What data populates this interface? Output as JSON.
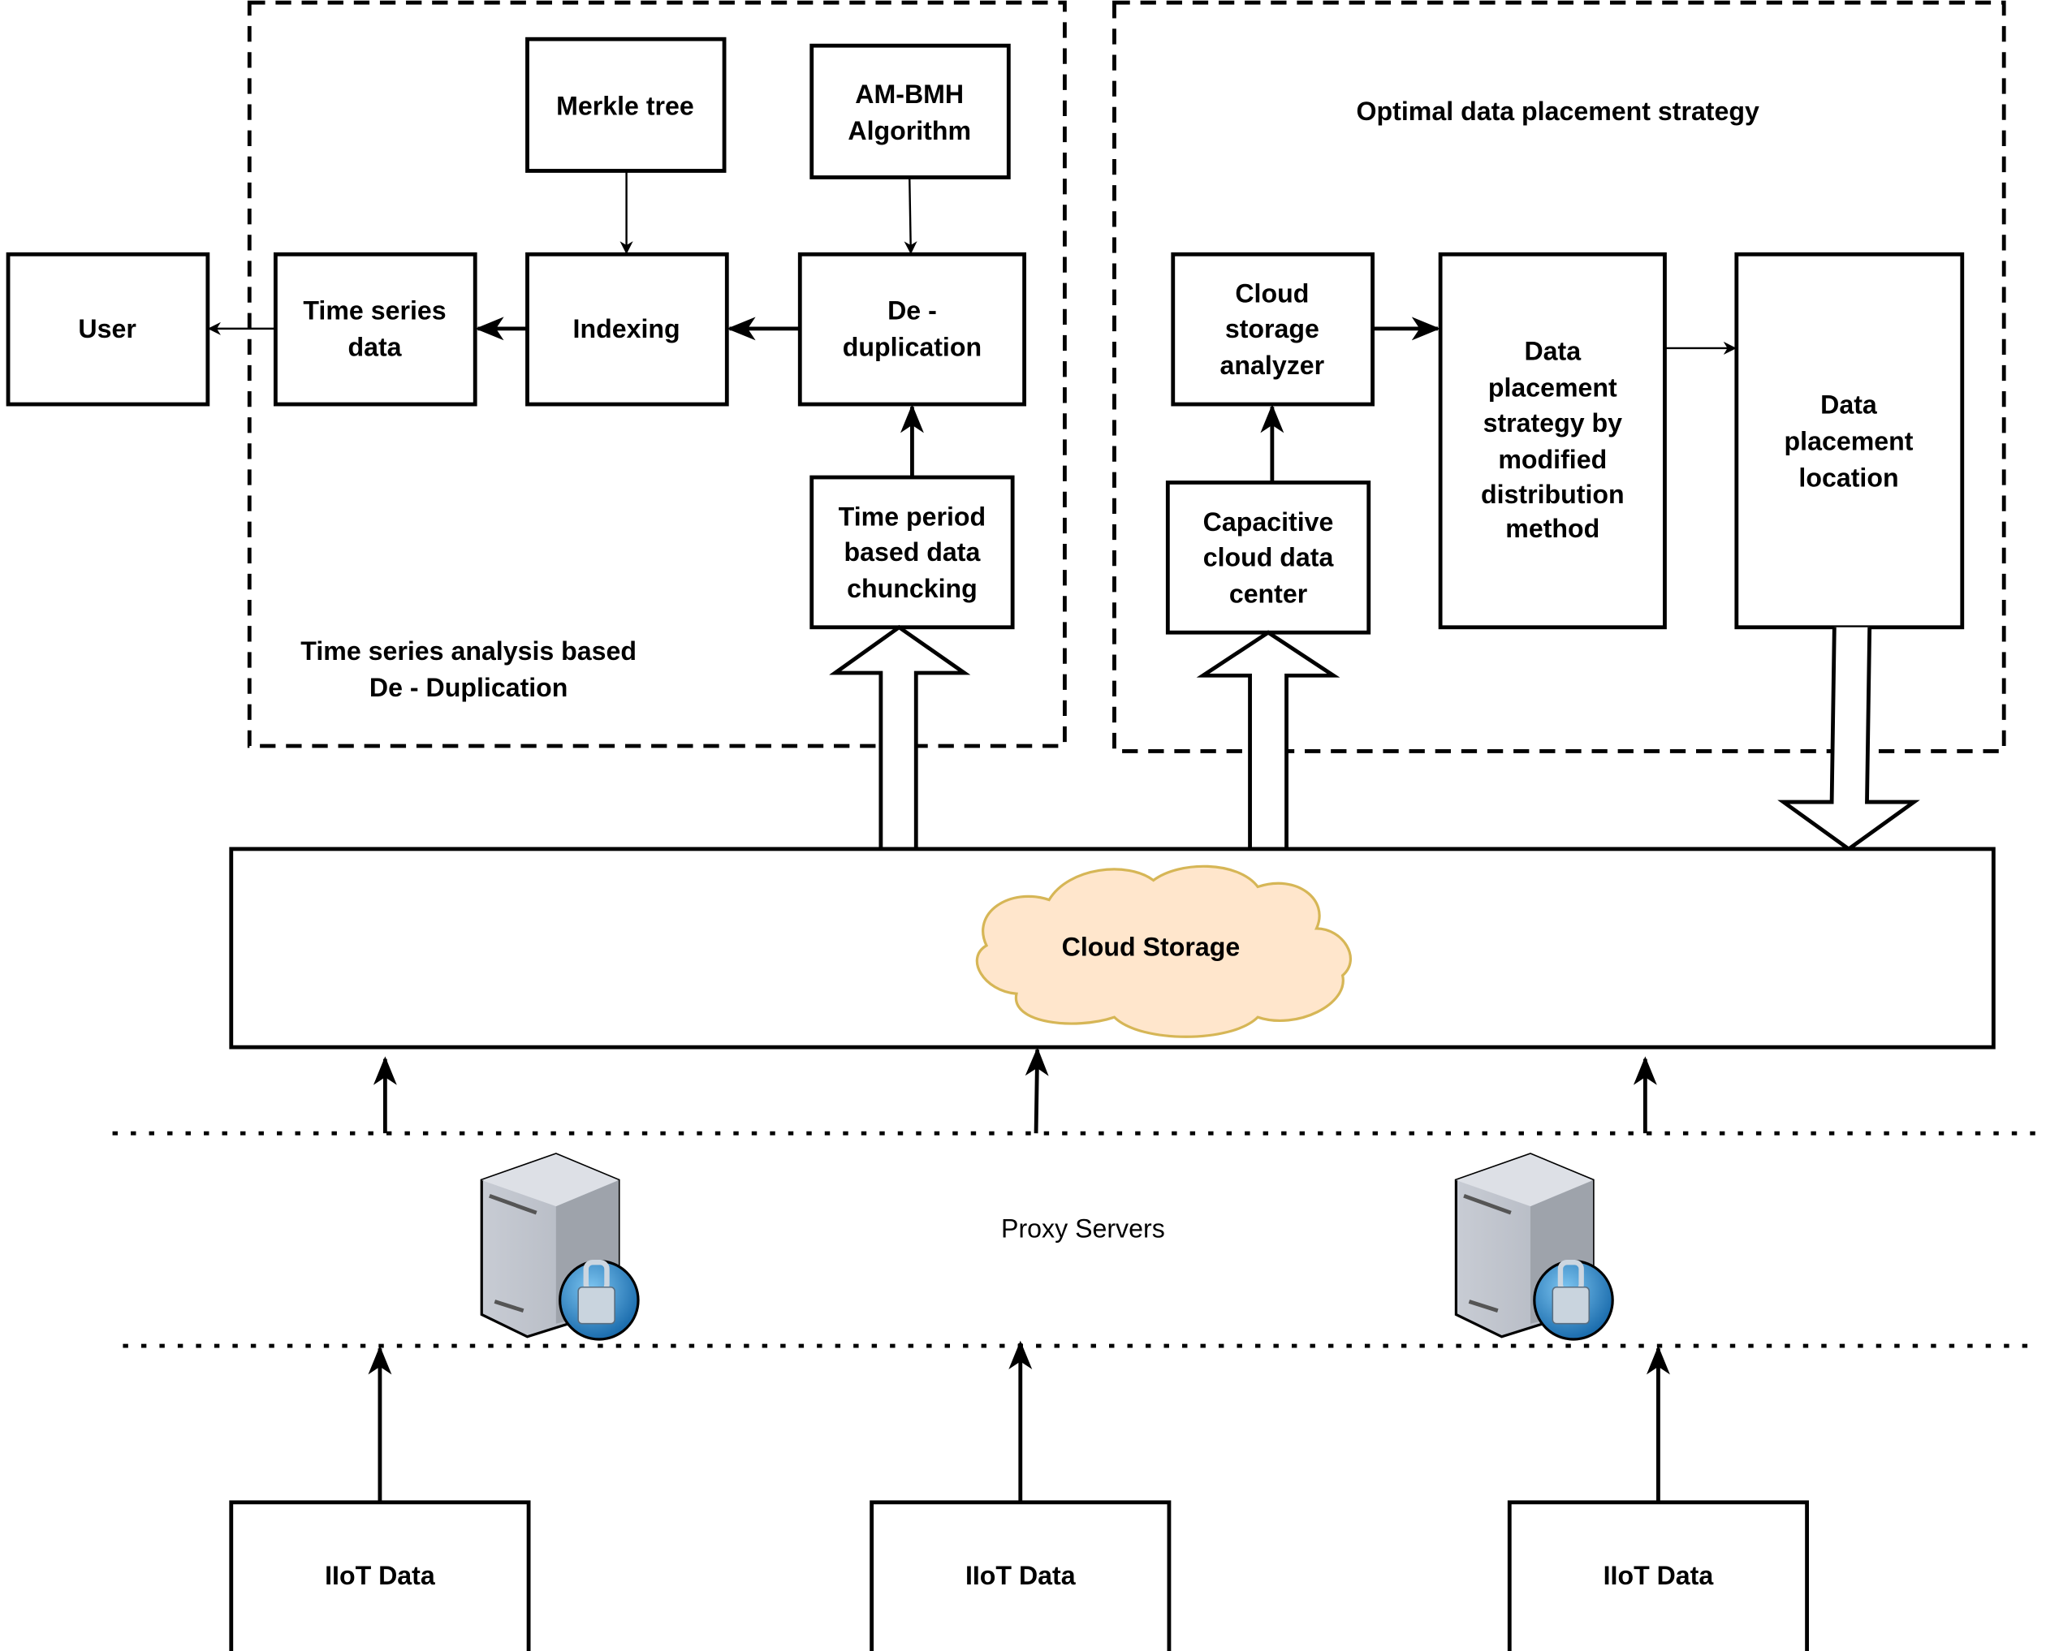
{
  "groups": {
    "dedup": {
      "title": [
        "Time series analysis based",
        "De - Duplication"
      ]
    },
    "placement": {
      "title": "Optimal data placement strategy"
    }
  },
  "nodes": {
    "user": [
      "User"
    ],
    "time_series_data": [
      "Time series",
      "data"
    ],
    "indexing": [
      "Indexing"
    ],
    "merkle_tree": [
      "Merkle tree"
    ],
    "am_bmh": [
      "AM-BMH",
      "Algorithm"
    ],
    "deduplication": [
      "De -",
      "duplication"
    ],
    "chunking": [
      "Time period",
      "based data",
      "chuncking"
    ],
    "cloud_storage_analyzer": [
      "Cloud",
      "storage",
      "analyzer"
    ],
    "capacitive_center": [
      "Capacitive",
      "cloud data",
      "center"
    ],
    "placement_strategy": [
      "Data",
      "placement",
      "strategy by",
      "modified",
      "distribution",
      "method"
    ],
    "placement_location": [
      "Data",
      "placement",
      "location"
    ],
    "cloud_storage": "Cloud Storage",
    "proxy_servers": "Proxy Servers",
    "iiot": [
      "IIoT Data",
      "IIoT Data",
      "IIoT Data"
    ]
  },
  "icons": {
    "proxy_server": "server-lock-icon"
  },
  "colors": {
    "cloud_fill": "#FFE6CC",
    "cloud_stroke": "#D6B656",
    "server_lock": "#1E88D0"
  }
}
